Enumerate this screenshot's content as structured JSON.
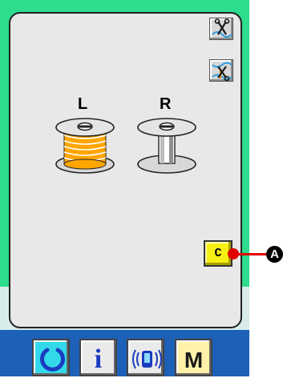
{
  "bobbins": {
    "left": {
      "label": "L"
    },
    "right": {
      "label": "R"
    }
  },
  "panel": {
    "clear_button_label": "C"
  },
  "callout": {
    "badge": "A"
  },
  "bottom_bar": {
    "info_label": "i",
    "mode_label": "M"
  },
  "colors": {
    "frame_green": "#2ddc8c",
    "thread_orange": "#ffa500",
    "clear_button_yellow": "#f6ef14",
    "bottom_bar_blue": "#1c60b8",
    "ready_tab_cyan": "#33d8ea",
    "callout_red": "#e00000"
  },
  "icons": {
    "side_buttons": [
      "thread-trimmer-icon",
      "thread-trimmer-off-icon"
    ],
    "bottom_tabs": [
      "ready-icon",
      "info-icon",
      "communication-icon",
      "mode-icon"
    ]
  }
}
